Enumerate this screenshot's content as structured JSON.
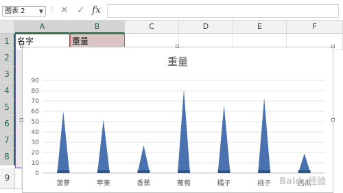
{
  "formula_bar": {
    "name_box": "图表 2",
    "dots": "⋮",
    "cancel_glyph": "✕",
    "confirm_glyph": "✓",
    "fx_label": "fx",
    "formula": ""
  },
  "columns": [
    "A",
    "B",
    "C",
    "D",
    "E",
    "F"
  ],
  "rows": [
    "1",
    "2",
    "3",
    "4",
    "5",
    "6",
    "7",
    "8",
    "9"
  ],
  "cells": {
    "a1": "名字",
    "b1": "重量"
  },
  "watermark": "Baidu经验",
  "accent_color": "#217346",
  "series_color": "#4a72b0",
  "chart_data": {
    "type": "bar",
    "bar_shape": "cone",
    "title": "重量",
    "categories": [
      "菠萝",
      "苹果",
      "香蕉",
      "葡萄",
      "橘子",
      "桃子",
      "西瓜"
    ],
    "values": [
      60,
      52,
      27,
      81,
      66,
      73,
      19
    ],
    "ylim": [
      0,
      90
    ],
    "yticks": [
      "0",
      "10",
      "20",
      "30",
      "40",
      "50",
      "60",
      "70",
      "80",
      "90"
    ],
    "grid": true
  }
}
